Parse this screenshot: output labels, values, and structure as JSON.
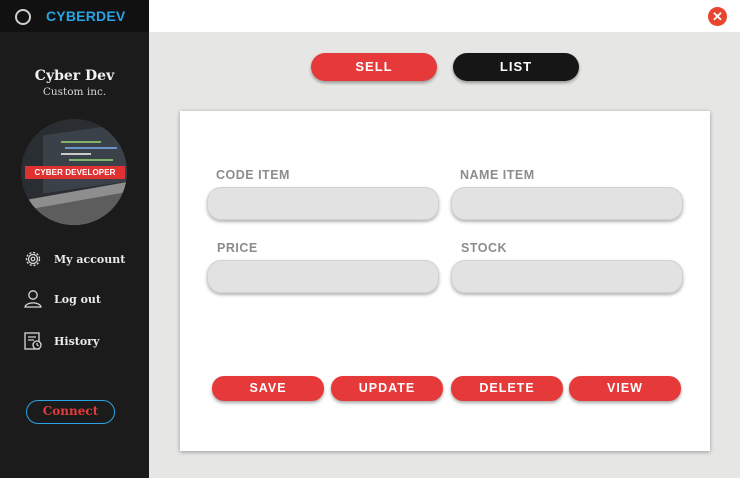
{
  "app": {
    "title": "CYBERDEV",
    "company_name": "Cyber Dev",
    "company_subtitle": "Custom inc.",
    "avatar_badge": "CYBER DEVELOPER"
  },
  "sidebar": {
    "items": [
      {
        "label": "My account",
        "icon": "gear-icon"
      },
      {
        "label": "Log out",
        "icon": "user-icon"
      },
      {
        "label": "History",
        "icon": "history-icon"
      }
    ],
    "connect_label": "Connect"
  },
  "window": {
    "close_glyph": "✕"
  },
  "tabs": {
    "sell_label": "SELL",
    "list_label": "LIST"
  },
  "form": {
    "code_item_label": "CODE ITEM",
    "name_item_label": "NAME ITEM",
    "price_label": "PRICE",
    "stock_label": "STOCK",
    "code_item_value": "",
    "name_item_value": "",
    "price_value": "",
    "stock_value": ""
  },
  "actions": {
    "save_label": "SAVE",
    "update_label": "UPDATE",
    "delete_label": "DELETE",
    "view_label": "VIEW"
  },
  "colors": {
    "accent_red": "#e6393a",
    "brand_blue": "#27a3e6",
    "sidebar_bg": "#1b1b1b"
  }
}
